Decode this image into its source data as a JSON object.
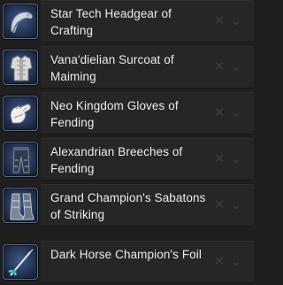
{
  "items": [
    {
      "label": "Star Tech Headgear of Crafting",
      "icon": "headgear-icon"
    },
    {
      "label": "Vana'dielian Surcoat of Maiming",
      "icon": "surcoat-icon"
    },
    {
      "label": "Neo Kingdom Gloves of Fending",
      "icon": "gloves-icon"
    },
    {
      "label": "Alexandrian Breeches of Fending",
      "icon": "breeches-icon"
    },
    {
      "label": "Grand Champion's Sabatons of Striking",
      "icon": "sabatons-icon"
    },
    {
      "label": "Dark Horse Champion's Foil",
      "icon": "foil-icon"
    }
  ],
  "controls": {
    "clear_glyph": "✕",
    "dropdown_glyph": "⌄"
  },
  "colors": {
    "icon_frame": "#5d6f8f",
    "row_bg": "#262626",
    "text": "#ececec"
  }
}
